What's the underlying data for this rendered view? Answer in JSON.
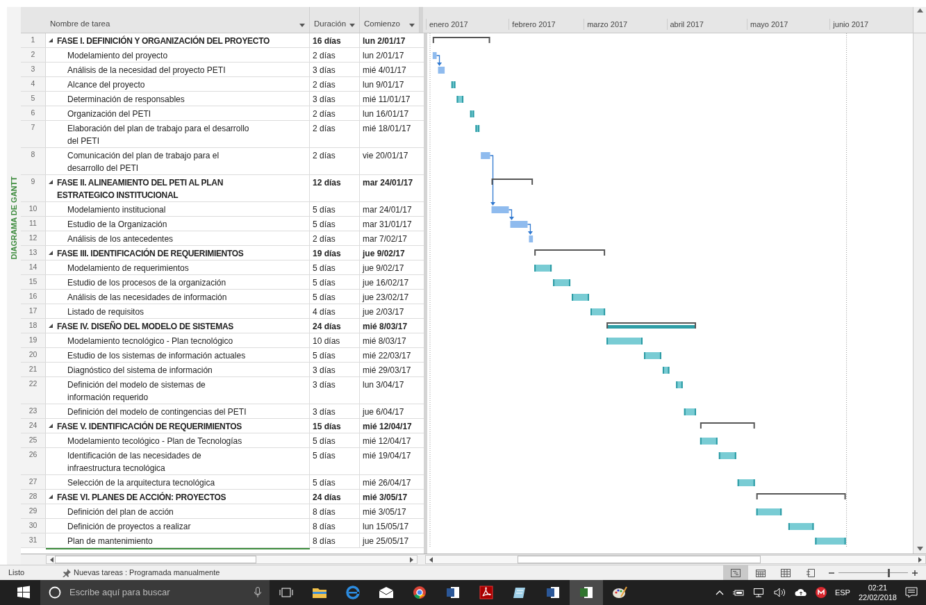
{
  "side_label": "DIAGRAMA DE GANTT",
  "columns": [
    "Nombre de tarea",
    "Duración",
    "Comienzo"
  ],
  "months": [
    "enero 2017",
    "febrero 2017",
    "marzo 2017",
    "abril 2017",
    "mayo 2017",
    "junio 2017"
  ],
  "rows": [
    {
      "id": "1",
      "kind": "phase",
      "expanded": true,
      "name": "FASE I. DEFINICIÓN Y ORGANIZACIÓN DEL PROYECTO",
      "duration": "16 días",
      "start": "lun 2/01/17"
    },
    {
      "id": "2",
      "kind": "task",
      "manual": true,
      "link": true,
      "name": "Modelamiento del proyecto",
      "duration": "2 días",
      "start": "lun 2/01/17"
    },
    {
      "id": "3",
      "kind": "task",
      "manual": true,
      "name": "Análisis de la necesidad del proyecto PETI",
      "duration": "3 días",
      "start": "mié 4/01/17"
    },
    {
      "id": "4",
      "kind": "task",
      "manual": false,
      "name": "Alcance del proyecto",
      "duration": "2 días",
      "start": "lun 9/01/17"
    },
    {
      "id": "5",
      "kind": "task",
      "manual": false,
      "name": "Determinación de responsables",
      "duration": "3 días",
      "start": "mié 11/01/17"
    },
    {
      "id": "6",
      "kind": "task",
      "manual": false,
      "name": "Organización del PETI",
      "duration": "2 días",
      "start": "lun 16/01/17"
    },
    {
      "id": "7",
      "kind": "task",
      "manual": false,
      "name": "Elaboración del plan de trabajo para el desarrollo\ndel PETI",
      "duration": "2 días",
      "start": "mié 18/01/17"
    },
    {
      "id": "8",
      "kind": "task",
      "manual": true,
      "link": true,
      "name": "Comunicación del plan de trabajo para el\ndesarrollo del PETI",
      "duration": "2 días",
      "start": "vie 20/01/17"
    },
    {
      "id": "9",
      "kind": "phase",
      "expanded": true,
      "name": "FASE II. ALINEAMIENTO DEL PETI AL PLAN\nESTRATEGICO INSTITUCIONAL",
      "duration": "12 días",
      "start": "mar 24/01/17"
    },
    {
      "id": "10",
      "kind": "task",
      "manual": true,
      "link": true,
      "name": "Modelamiento institucional",
      "duration": "5 días",
      "start": "mar 24/01/17"
    },
    {
      "id": "11",
      "kind": "task",
      "manual": true,
      "link": true,
      "name": "Estudio de la Organización",
      "duration": "5 días",
      "start": "mar 31/01/17"
    },
    {
      "id": "12",
      "kind": "task",
      "manual": true,
      "name": "Análisis de los antecedentes",
      "duration": "2 días",
      "start": "mar 7/02/17"
    },
    {
      "id": "13",
      "kind": "phase",
      "expanded": true,
      "name": "FASE III. IDENTIFICACIÓN DE REQUERIMIENTOS",
      "duration": "19 días",
      "start": "jue 9/02/17"
    },
    {
      "id": "14",
      "kind": "task",
      "manual": false,
      "name": "Modelamiento de requerimientos",
      "duration": "5 días",
      "start": "jue 9/02/17"
    },
    {
      "id": "15",
      "kind": "task",
      "manual": false,
      "name": "Estudio de los procesos de la organización",
      "duration": "5 días",
      "start": "jue 16/02/17"
    },
    {
      "id": "16",
      "kind": "task",
      "manual": false,
      "name": "Análisis de las necesidades de información",
      "duration": "5 días",
      "start": "jue 23/02/17"
    },
    {
      "id": "17",
      "kind": "task",
      "manual": false,
      "name": "Listado de requisitos",
      "duration": "4 días",
      "start": "jue 2/03/17"
    },
    {
      "id": "18",
      "kind": "phase",
      "expanded": true,
      "summary_fill": true,
      "name": "FASE IV. DISEÑO DEL MODELO DE SISTEMAS",
      "duration": "24 días",
      "start": "mié 8/03/17"
    },
    {
      "id": "19",
      "kind": "task",
      "manual": false,
      "name": "Modelamiento tecnológico - Plan tecnológico",
      "duration": "10 días",
      "start": "mié 8/03/17"
    },
    {
      "id": "20",
      "kind": "task",
      "manual": false,
      "name": "Estudio de los sistemas de información actuales",
      "duration": "5 días",
      "start": "mié 22/03/17"
    },
    {
      "id": "21",
      "kind": "task",
      "manual": false,
      "name": "Diagnóstico del sistema de información",
      "duration": "3 días",
      "start": "mié 29/03/17"
    },
    {
      "id": "22",
      "kind": "task",
      "manual": false,
      "name": "Definición del modelo de sistemas de\ninformación requerido",
      "duration": "3 días",
      "start": "lun 3/04/17"
    },
    {
      "id": "23",
      "kind": "task",
      "manual": false,
      "name": "Definición del modelo de contingencias del PETI",
      "duration": "3 días",
      "start": "jue 6/04/17"
    },
    {
      "id": "24",
      "kind": "phase",
      "expanded": true,
      "name": "FASE V. IDENTIFICACIÓN DE REQUERIMIENTOS",
      "duration": "15 días",
      "start": "mié 12/04/17"
    },
    {
      "id": "25",
      "kind": "task",
      "manual": false,
      "name": "Modelamiento tecológico - Plan de Tecnologías",
      "duration": "5 días",
      "start": "mié 12/04/17"
    },
    {
      "id": "26",
      "kind": "task",
      "manual": false,
      "name": "Identificación de las necesidades de\ninfraestructura tecnológica",
      "duration": "5 días",
      "start": "mié 19/04/17"
    },
    {
      "id": "27",
      "kind": "task",
      "manual": false,
      "name": "Selección de la arquitectura tecnológica",
      "duration": "5 días",
      "start": "mié 26/04/17"
    },
    {
      "id": "28",
      "kind": "phase",
      "expanded": true,
      "name": "FASE VI. PLANES DE ACCIÓN: PROYECTOS",
      "duration": "24 días",
      "start": "mié 3/05/17"
    },
    {
      "id": "29",
      "kind": "task",
      "manual": false,
      "name": "Definición del plan de acción",
      "duration": "8 días",
      "start": "mié 3/05/17"
    },
    {
      "id": "30",
      "kind": "task",
      "manual": false,
      "name": "Definición de proyectos a realizar",
      "duration": "8 días",
      "start": "lun 15/05/17"
    },
    {
      "id": "31",
      "kind": "task",
      "manual": false,
      "name": "Plan de mantenimiento",
      "duration": "8 días",
      "start": "jue 25/05/17"
    }
  ],
  "status_bar": {
    "status": "Listo",
    "new_tasks": "Nuevas tareas : Programada manualmente",
    "views": [
      {
        "kind": "gantt",
        "selected": true
      },
      {
        "kind": "calendar",
        "selected": false
      },
      {
        "kind": "sheet",
        "selected": false
      },
      {
        "kind": "report",
        "selected": false
      }
    ],
    "zoom": {
      "level": 0.72
    }
  },
  "taskbar": {
    "search_placeholder": "Escribe aquí para buscar",
    "language": "ESP",
    "time": "02:21",
    "date": "22/02/2018"
  }
}
